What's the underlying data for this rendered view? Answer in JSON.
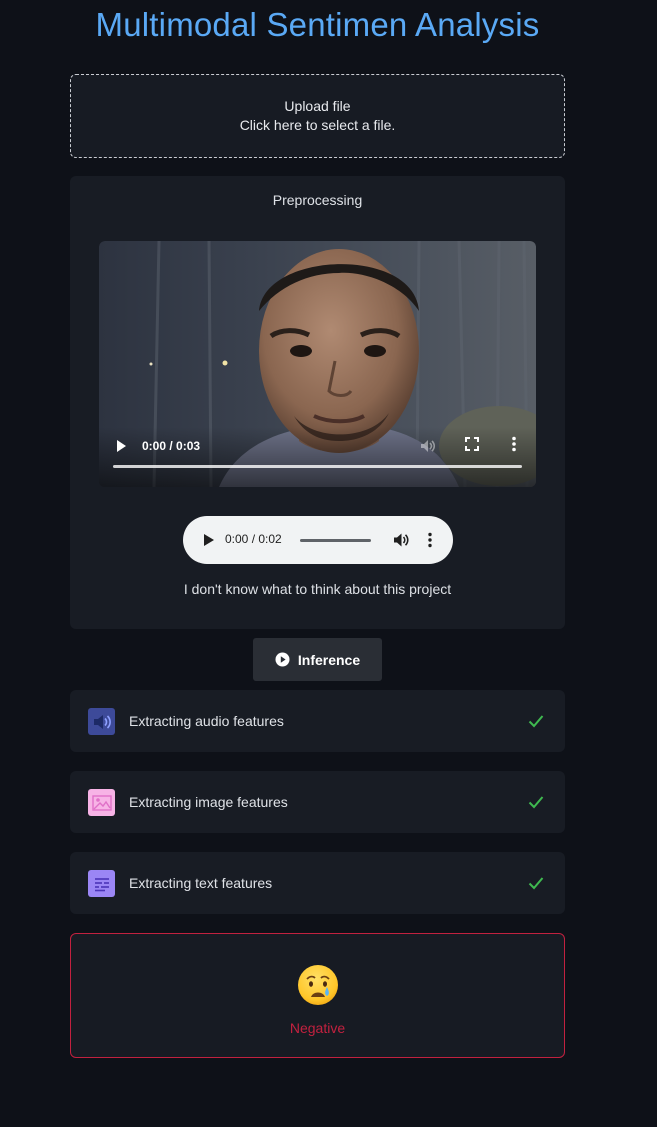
{
  "header": {
    "title": "Multimodal Sentimen Analysis"
  },
  "upload": {
    "title": "Upload file",
    "hint": "Click here to select a file."
  },
  "preprocessing": {
    "title": "Preprocessing",
    "video": {
      "time": "0:00 / 0:03",
      "progress": 0
    },
    "audio": {
      "time": "0:00 / 0:02",
      "progress": 0
    },
    "transcript": "I don't know what to think about this project"
  },
  "inference": {
    "label": "Inference"
  },
  "steps": [
    {
      "label": "Extracting audio features",
      "icon": "speaker-icon",
      "status": "done",
      "color": "#3d4a99"
    },
    {
      "label": "Extracting image features",
      "icon": "image-icon",
      "status": "done",
      "color": "#f7b3e6"
    },
    {
      "label": "Extracting text features",
      "icon": "text-lines-icon",
      "status": "done",
      "color": "#9b86f5"
    }
  ],
  "result": {
    "emoji_icon": "crying-face-icon",
    "label": "Negative",
    "color": "#c2213f"
  },
  "colors": {
    "accent": "#5aa9f5",
    "background": "#0e1118",
    "card": "#181c24",
    "check": "#3fb950"
  }
}
